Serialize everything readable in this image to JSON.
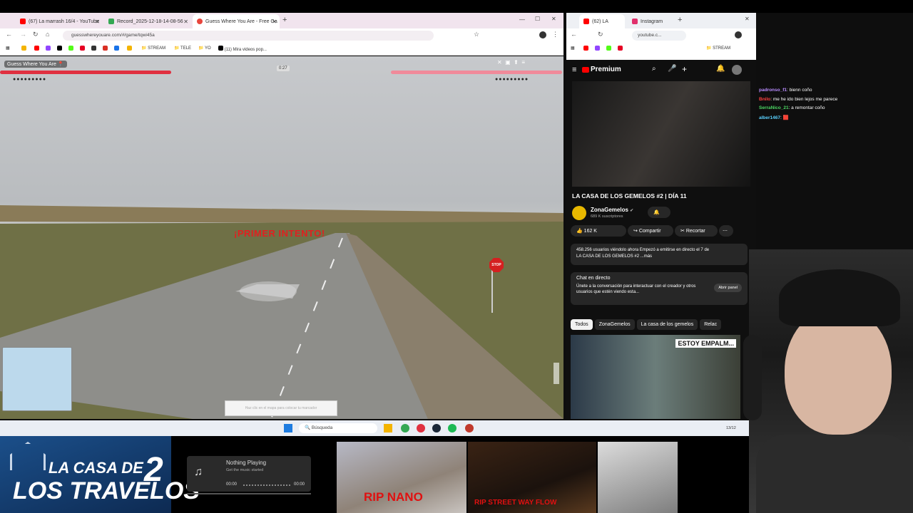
{
  "left_browser": {
    "tabs": [
      {
        "label": "(67) La marrash 16/4 - YouTube",
        "color": "#ff0000"
      },
      {
        "label": "Record_2025-12-18-14-08-56",
        "color": "#34a853"
      },
      {
        "label": "Guess Where You Are - Free Ga",
        "color": "#e8453c"
      }
    ],
    "url": "guesswhereyouare.com/#/game/tqwi45a",
    "bookmarks": [
      "STREAM",
      "TELE",
      "YO",
      "(11) Mira videos pop..."
    ]
  },
  "game": {
    "title": "Guess Where You Are",
    "timer": "0:27",
    "banner": "¡PRIMER INTENTO!",
    "stop_sign": "STOP",
    "guess_button": "Haz clic en el mapa para colocar tu marcador"
  },
  "taskbar": {
    "search_placeholder": "Búsqueda",
    "time": "13/12"
  },
  "right_browser": {
    "tabs": [
      {
        "label": "(62) LA",
        "color": "#ff0000"
      },
      {
        "label": "Instagram",
        "color": "#e1306c"
      }
    ],
    "url": "youtube.c...",
    "bookmarks": [
      "STREAM"
    ]
  },
  "youtube": {
    "brand": "Premium",
    "video_title": "LA CASA DE LOS GEMELOS #2 | DÍA 11",
    "channel": "ZonaGemelos",
    "subscribers": "689 K suscriptores",
    "likes": "162 K",
    "share": "Compartir",
    "clip": "Recortar",
    "description": "458.256 usuarios viéndolo ahora  Empezó a emitirse en directo el 7 de",
    "description2": "LA CASA DE LOS GEMELOS #2 ...más",
    "chat_title": "Chat en directo",
    "chat_text": "Únete a la conversación para interactuar con el creador y otros usuarios que estén viendo esta...",
    "chat_button": "Abrir panel",
    "chips": [
      "Todos",
      "ZonaGemelos",
      "La casa de los gemelos",
      "Relac"
    ],
    "thumb_text": "ESTOY EMPALM..."
  },
  "stream_chat": [
    {
      "user": "padronso_f1",
      "msg": ": bienn coño",
      "color": "#b98cff"
    },
    {
      "user": "Bnilo",
      "msg": ": me he ido bien lejos me parece",
      "color": "#ff4040"
    },
    {
      "user": "SerraNico_21",
      "msg": ": a remontar coño",
      "color": "#4cd964"
    },
    {
      "user": "alber1467",
      "msg": ": 🟥",
      "color": "#5ad1ff"
    }
  ],
  "overlay": {
    "logo_line1": "LA CASA DE",
    "logo_line2": "LOS TRAVELOS",
    "logo_num": "2",
    "now_playing": "Nothing Playing",
    "now_playing_sub": "Get the music started",
    "time_start": "00:00",
    "time_end": "00:00",
    "rip": "RIP NANO",
    "flow": "RIP STREET WAY FLOW"
  }
}
